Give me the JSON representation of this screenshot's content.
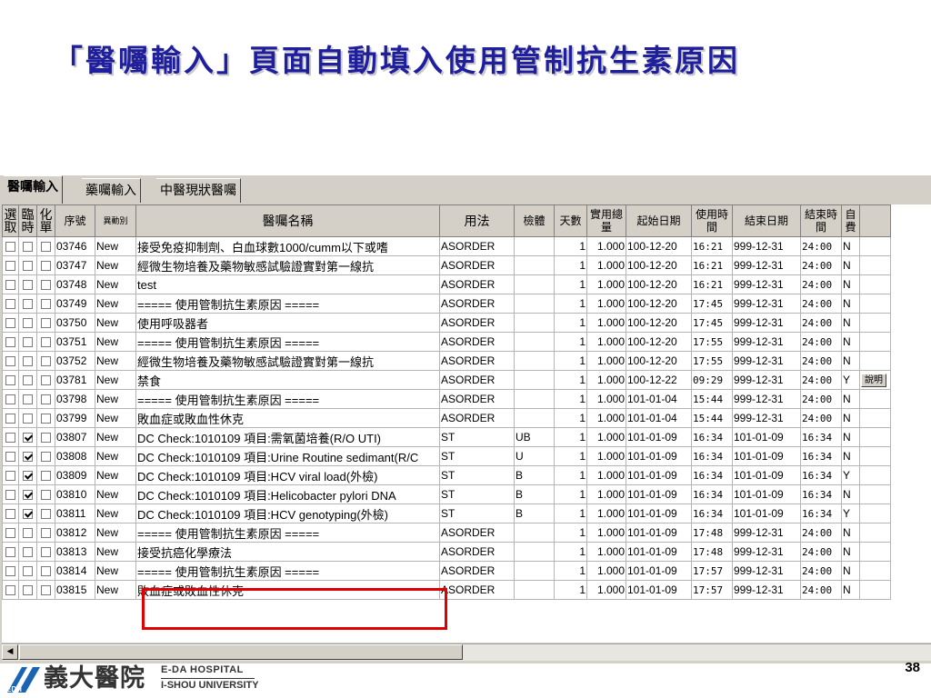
{
  "slide": {
    "title": "「醫囑輸入」頁面自動填入使用管制抗生素原因",
    "page_number": "38"
  },
  "tabs": [
    "醫囑輸入",
    "藥囑輸入",
    "中醫現狀醫囑"
  ],
  "grid": {
    "headers": {
      "select": "選取",
      "temp": "臨時",
      "split": "化單",
      "seq": "序號",
      "change": "異動別",
      "name": "醫囑名稱",
      "usage": "用法",
      "specimen": "檢體",
      "days": "天數",
      "qty": "實用總量",
      "start_date": "起始日期",
      "use_time": "使用時間",
      "end_date": "結束日期",
      "end_time": "結束時間",
      "self_pay": "自費"
    },
    "rows": [
      {
        "sel": false,
        "tmp": false,
        "spl": false,
        "seq": "03746",
        "chg": "New",
        "name": "接受免疫抑制劑、白血球數1000/cumm以下或嗜",
        "usage": "ASORDER",
        "spec": "",
        "days": "1",
        "qty": "1.000",
        "start": "100-12-20",
        "use_time": "16:21",
        "end": "999-12-31",
        "end_time": "24:00",
        "self": "N",
        "extra": ""
      },
      {
        "sel": false,
        "tmp": false,
        "spl": false,
        "seq": "03747",
        "chg": "New",
        "name": "經微生物培養及藥物敏感試驗證實對第一線抗",
        "usage": "ASORDER",
        "spec": "",
        "days": "1",
        "qty": "1.000",
        "start": "100-12-20",
        "use_time": "16:21",
        "end": "999-12-31",
        "end_time": "24:00",
        "self": "N",
        "extra": ""
      },
      {
        "sel": false,
        "tmp": false,
        "spl": false,
        "seq": "03748",
        "chg": "New",
        "name": "test",
        "usage": "ASORDER",
        "spec": "",
        "days": "1",
        "qty": "1.000",
        "start": "100-12-20",
        "use_time": "16:21",
        "end": "999-12-31",
        "end_time": "24:00",
        "self": "N",
        "extra": ""
      },
      {
        "sel": false,
        "tmp": false,
        "spl": false,
        "seq": "03749",
        "chg": "New",
        "name": "===== 使用管制抗生素原因 =====",
        "usage": "ASORDER",
        "spec": "",
        "days": "1",
        "qty": "1.000",
        "start": "100-12-20",
        "use_time": "17:45",
        "end": "999-12-31",
        "end_time": "24:00",
        "self": "N",
        "extra": ""
      },
      {
        "sel": false,
        "tmp": false,
        "spl": false,
        "seq": "03750",
        "chg": "New",
        "name": "使用呼吸器者",
        "usage": "ASORDER",
        "spec": "",
        "days": "1",
        "qty": "1.000",
        "start": "100-12-20",
        "use_time": "17:45",
        "end": "999-12-31",
        "end_time": "24:00",
        "self": "N",
        "extra": ""
      },
      {
        "sel": false,
        "tmp": false,
        "spl": false,
        "seq": "03751",
        "chg": "New",
        "name": "===== 使用管制抗生素原因 =====",
        "usage": "ASORDER",
        "spec": "",
        "days": "1",
        "qty": "1.000",
        "start": "100-12-20",
        "use_time": "17:55",
        "end": "999-12-31",
        "end_time": "24:00",
        "self": "N",
        "extra": ""
      },
      {
        "sel": false,
        "tmp": false,
        "spl": false,
        "seq": "03752",
        "chg": "New",
        "name": "經微生物培養及藥物敏感試驗證實對第一線抗",
        "usage": "ASORDER",
        "spec": "",
        "days": "1",
        "qty": "1.000",
        "start": "100-12-20",
        "use_time": "17:55",
        "end": "999-12-31",
        "end_time": "24:00",
        "self": "N",
        "extra": ""
      },
      {
        "sel": false,
        "tmp": false,
        "spl": false,
        "seq": "03781",
        "chg": "New",
        "name": "禁食",
        "usage": "ASORDER",
        "spec": "",
        "days": "1",
        "qty": "1.000",
        "start": "100-12-22",
        "use_time": "09:29",
        "end": "999-12-31",
        "end_time": "24:00",
        "self": "Y",
        "extra": "說明"
      },
      {
        "sel": false,
        "tmp": false,
        "spl": false,
        "seq": "03798",
        "chg": "New",
        "name": "===== 使用管制抗生素原因 =====",
        "usage": "ASORDER",
        "spec": "",
        "days": "1",
        "qty": "1.000",
        "start": "101-01-04",
        "use_time": "15:44",
        "end": "999-12-31",
        "end_time": "24:00",
        "self": "N",
        "extra": ""
      },
      {
        "sel": false,
        "tmp": false,
        "spl": false,
        "seq": "03799",
        "chg": "New",
        "name": "敗血症或敗血性休克",
        "usage": "ASORDER",
        "spec": "",
        "days": "1",
        "qty": "1.000",
        "start": "101-01-04",
        "use_time": "15:44",
        "end": "999-12-31",
        "end_time": "24:00",
        "self": "N",
        "extra": ""
      },
      {
        "sel": false,
        "tmp": true,
        "spl": false,
        "seq": "03807",
        "chg": "New",
        "name": "DC Check:1010109 項目:需氧菌培養(R/O UTI)",
        "usage": "ST",
        "spec": "UB",
        "days": "1",
        "qty": "1.000",
        "start": "101-01-09",
        "use_time": "16:34",
        "end": "101-01-09",
        "end_time": "16:34",
        "self": "N",
        "extra": ""
      },
      {
        "sel": false,
        "tmp": true,
        "spl": false,
        "seq": "03808",
        "chg": "New",
        "name": "DC Check:1010109 項目:Urine Routine sedimant(R/C",
        "usage": "ST",
        "spec": "U",
        "days": "1",
        "qty": "1.000",
        "start": "101-01-09",
        "use_time": "16:34",
        "end": "101-01-09",
        "end_time": "16:34",
        "self": "N",
        "extra": ""
      },
      {
        "sel": false,
        "tmp": true,
        "spl": false,
        "seq": "03809",
        "chg": "New",
        "name": "DC Check:1010109 項目:HCV viral load(外檢)",
        "usage": "ST",
        "spec": "B",
        "days": "1",
        "qty": "1.000",
        "start": "101-01-09",
        "use_time": "16:34",
        "end": "101-01-09",
        "end_time": "16:34",
        "self": "Y",
        "extra": ""
      },
      {
        "sel": false,
        "tmp": true,
        "spl": false,
        "seq": "03810",
        "chg": "New",
        "name": "DC Check:1010109 項目:Helicobacter pylori DNA",
        "usage": "ST",
        "spec": "B",
        "days": "1",
        "qty": "1.000",
        "start": "101-01-09",
        "use_time": "16:34",
        "end": "101-01-09",
        "end_time": "16:34",
        "self": "N",
        "extra": ""
      },
      {
        "sel": false,
        "tmp": true,
        "spl": false,
        "seq": "03811",
        "chg": "New",
        "name": "DC Check:1010109 項目:HCV genotyping(外檢)",
        "usage": "ST",
        "spec": "B",
        "days": "1",
        "qty": "1.000",
        "start": "101-01-09",
        "use_time": "16:34",
        "end": "101-01-09",
        "end_time": "16:34",
        "self": "Y",
        "extra": ""
      },
      {
        "sel": false,
        "tmp": false,
        "spl": false,
        "seq": "03812",
        "chg": "New",
        "name": "===== 使用管制抗生素原因 =====",
        "usage": "ASORDER",
        "spec": "",
        "days": "1",
        "qty": "1.000",
        "start": "101-01-09",
        "use_time": "17:48",
        "end": "999-12-31",
        "end_time": "24:00",
        "self": "N",
        "extra": ""
      },
      {
        "sel": false,
        "tmp": false,
        "spl": false,
        "seq": "03813",
        "chg": "New",
        "name": "接受抗癌化學療法",
        "usage": "ASORDER",
        "spec": "",
        "days": "1",
        "qty": "1.000",
        "start": "101-01-09",
        "use_time": "17:48",
        "end": "999-12-31",
        "end_time": "24:00",
        "self": "N",
        "extra": ""
      },
      {
        "sel": false,
        "tmp": false,
        "spl": false,
        "seq": "03814",
        "chg": "New",
        "name": "===== 使用管制抗生素原因 =====",
        "usage": "ASORDER",
        "spec": "",
        "days": "1",
        "qty": "1.000",
        "start": "101-01-09",
        "use_time": "17:57",
        "end": "999-12-31",
        "end_time": "24:00",
        "self": "N",
        "extra": ""
      },
      {
        "sel": false,
        "tmp": false,
        "spl": false,
        "seq": "03815",
        "chg": "New",
        "name": "敗血症或敗血性休克",
        "usage": "ASORDER",
        "spec": "",
        "days": "1",
        "qty": "1.000",
        "start": "101-01-09",
        "use_time": "17:57",
        "end": "999-12-31",
        "end_time": "24:00",
        "self": "N",
        "extra": ""
      }
    ]
  },
  "footer": {
    "logo_cn": "義大醫院",
    "logo_en_1": "E-DA HOSPITAL",
    "logo_en_2": "I-SHOU UNIVERSITY",
    "logo_badge": "EDH"
  },
  "colors": {
    "title": "#1f1f9e",
    "highlight": "#e00000",
    "logo_blue": "#1a64b4"
  }
}
